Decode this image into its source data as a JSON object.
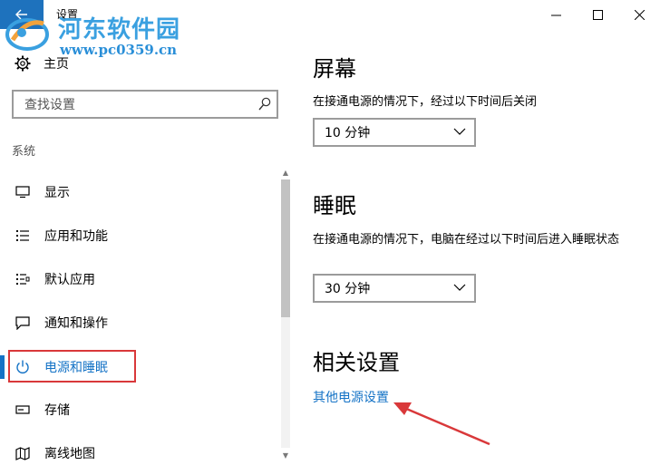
{
  "titlebar": {
    "title": "设置",
    "back_icon": "back-arrow-icon",
    "accent": "#1e72bd"
  },
  "watermark": {
    "name": "河东软件园",
    "url": "www.pc0359.cn"
  },
  "sidebar": {
    "home_label": "主页",
    "search_placeholder": "查找设置",
    "section_label": "系统",
    "items": [
      {
        "label": "显示",
        "icon": "display-icon"
      },
      {
        "label": "应用和功能",
        "icon": "apps-list-icon"
      },
      {
        "label": "默认应用",
        "icon": "default-apps-icon"
      },
      {
        "label": "通知和操作",
        "icon": "notification-icon"
      },
      {
        "label": "电源和睡眠",
        "icon": "power-icon",
        "active": true
      },
      {
        "label": "存储",
        "icon": "storage-icon"
      },
      {
        "label": "离线地图",
        "icon": "map-icon"
      }
    ]
  },
  "main": {
    "screen": {
      "heading": "屏幕",
      "description": "在接通电源的情况下，经过以下时间后关闭",
      "value": "10 分钟"
    },
    "sleep": {
      "heading": "睡眠",
      "description": "在接通电源的情况下，电脑在经过以下时间后进入睡眠状态",
      "value": "30 分钟"
    },
    "related": {
      "heading": "相关设置",
      "link": "其他电源设置"
    }
  },
  "colors": {
    "accent": "#1573c6",
    "annotation": "#d9383a"
  }
}
